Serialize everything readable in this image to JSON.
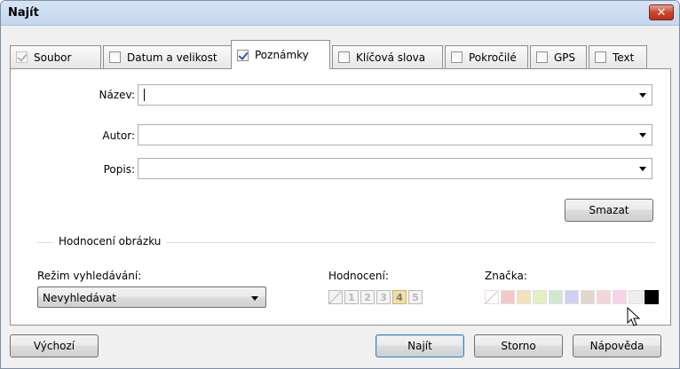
{
  "window": {
    "title": "Najít"
  },
  "tabs": [
    {
      "label": "Soubor",
      "checked": true,
      "disabled": true
    },
    {
      "label": "Datum a velikost",
      "checked": false
    },
    {
      "label": "Poznámky",
      "checked": true,
      "active": true
    },
    {
      "label": "Klíčová slova",
      "checked": false
    },
    {
      "label": "Pokročilé",
      "checked": false
    },
    {
      "label": "GPS",
      "checked": false
    },
    {
      "label": "Text",
      "checked": false
    }
  ],
  "fields": {
    "name_label": "Název:",
    "name_value": "",
    "author_label": "Autor:",
    "author_value": "",
    "description_label": "Popis:",
    "description_value": ""
  },
  "clear_button": "Smazat",
  "rating_group": {
    "title": "Hodnocení obrázku",
    "search_mode_label": "Režim vyhledávání:",
    "search_mode_value": "Nevyhledávat",
    "rating_label": "Hodnocení:",
    "rating_values": [
      "1",
      "2",
      "3",
      "4",
      "5"
    ],
    "rating_selected": "4",
    "label_label": "Značka:",
    "label_colors": [
      "#f5c8c8",
      "#f3e1bd",
      "#e6efc4",
      "#cfe8d2",
      "#d0cff2",
      "#e1d6cc",
      "#f5d6d6",
      "#f7d2ea",
      "#eeeeee",
      "#000000"
    ]
  },
  "footer": {
    "defaults_button": "Výchozí",
    "find_button": "Najít",
    "cancel_button": "Storno",
    "help_button": "Nápověda"
  },
  "colors": {
    "accent": "#3c7fb1",
    "close": "#c9462c"
  }
}
